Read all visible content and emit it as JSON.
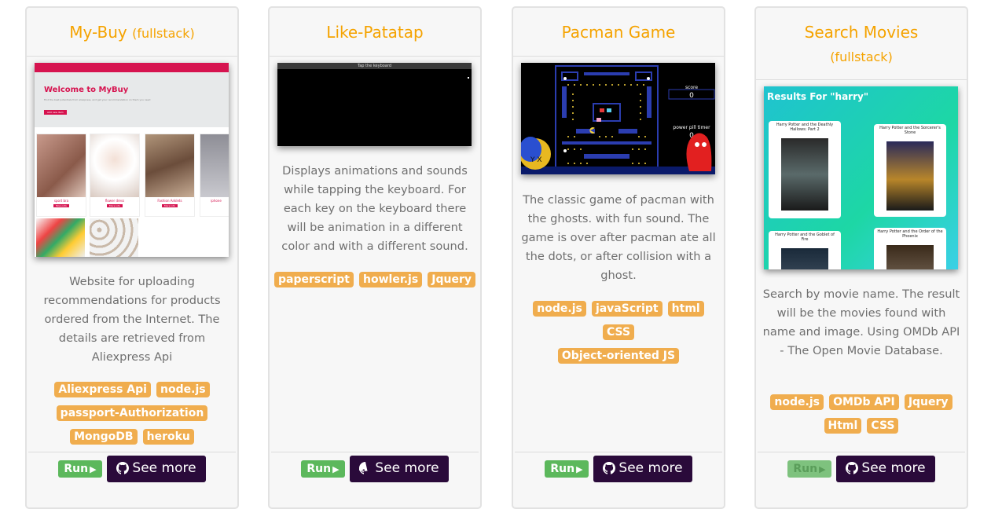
{
  "cards": [
    {
      "title": "My-Buy",
      "subtitle": "(fullstack)",
      "description": "Website for uploading recommendations for products ordered from the Internet. The details are retrieved from Aliexpress Api",
      "tags": [
        "Aliexpress Api",
        "node.js",
        "passport-Authorization",
        "MongoDB",
        "heroku"
      ],
      "run": "Run",
      "more": "See more",
      "preview": {
        "heading": "Welcome to MyBuy",
        "tagline": "Find the best potentials from aliexpress, and get your recommendation on them you need",
        "cta": "Add new item",
        "products": [
          "sport bra",
          "flower dress",
          "Fashion Anklets",
          "iphone"
        ],
        "product_button": "More info"
      }
    },
    {
      "title": "Like-Patatap",
      "description": "Displays animations and sounds while tapping the keyboard. For each key on the keyboard there will be animation in a different color and with a different sound.",
      "tags": [
        "paperscript",
        "howler.js",
        "Jquery"
      ],
      "run": "Run",
      "more": "See more",
      "preview": {
        "bar_text": "Tap the keyboard"
      }
    },
    {
      "title": "Pacman Game",
      "description": "The classic game of pacman with the ghosts. with fun sound. The game is over after pacman ate all the dots, or after collision with a ghost.",
      "tags": [
        "node.js",
        "javaScript",
        "html",
        "CSS",
        "Object-oriented JS"
      ],
      "run": "Run",
      "more": "See more",
      "preview": {
        "score_label": "score",
        "score_value": "0",
        "timer_label": "power pill timer",
        "timer_value": "0"
      }
    },
    {
      "title": "Search Movies",
      "subtitle": "(fullstack)",
      "description": "Search by movie name. The result will be the movies found with name and image. Using OMDb API - The Open Movie Database.",
      "tags": [
        "node.js",
        "OMDb API",
        "Jquery",
        "Html",
        "CSS"
      ],
      "run": "Run",
      "more": "See more",
      "preview": {
        "heading": "Results For \"harry\"",
        "movies": [
          "Harry Potter and the Deathly Hallows: Part 2",
          "Harry Potter and the Sorcerer's Stone",
          "Harry Potter and the Goblet of Fire",
          "Harry Potter and the Order of the Phoenix"
        ]
      }
    }
  ],
  "colors": {
    "title": "#f5a300",
    "tag": "#f0ad4e",
    "run": "#5cb85c",
    "more": "#2a0a3a"
  }
}
